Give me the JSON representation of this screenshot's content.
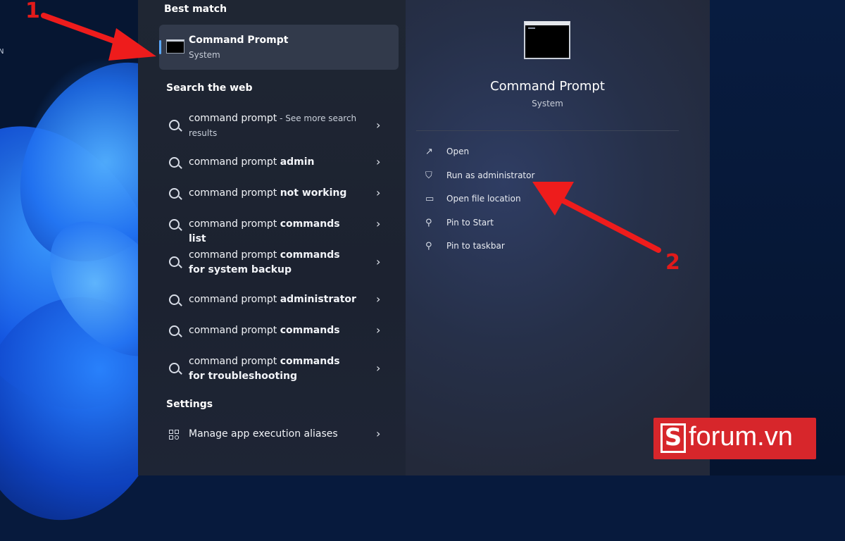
{
  "desktop": {
    "edge_letter": "N"
  },
  "search": {
    "best_match_label": "Best match",
    "best_match": {
      "title": "Command Prompt",
      "subtitle": "System"
    },
    "web_label": "Search the web",
    "web_results": [
      {
        "prefix": "command prompt",
        "bold": "",
        "suffix": " - See more search results"
      },
      {
        "prefix": "command prompt ",
        "bold": "admin",
        "suffix": ""
      },
      {
        "prefix": "command prompt ",
        "bold": "not working",
        "suffix": ""
      },
      {
        "prefix": "command prompt ",
        "bold": "commands list",
        "suffix": ""
      },
      {
        "prefix": "command prompt ",
        "bold": "commands for system backup",
        "suffix": ""
      },
      {
        "prefix": "command prompt ",
        "bold": "administrator",
        "suffix": ""
      },
      {
        "prefix": "command prompt ",
        "bold": "commands",
        "suffix": ""
      },
      {
        "prefix": "command prompt ",
        "bold": "commands for troubleshooting",
        "suffix": ""
      }
    ],
    "settings_label": "Settings",
    "settings_item": "Manage app execution aliases",
    "chevron": "›"
  },
  "preview": {
    "title": "Command Prompt",
    "subtitle": "System",
    "actions": [
      {
        "label": "Open",
        "icon": "open-icon"
      },
      {
        "label": "Run as administrator",
        "icon": "shield-icon"
      },
      {
        "label": "Open file location",
        "icon": "folder-icon"
      },
      {
        "label": "Pin to Start",
        "icon": "pin-icon"
      },
      {
        "label": "Pin to taskbar",
        "icon": "pin-icon"
      }
    ]
  },
  "annotations": {
    "step1": "1",
    "step2": "2"
  },
  "watermark": {
    "s": "S",
    "text": "forum.vn"
  },
  "colors": {
    "annotation": "#e11a1a",
    "accent": "#5aa9ff",
    "logo_bg": "#d7262b"
  }
}
